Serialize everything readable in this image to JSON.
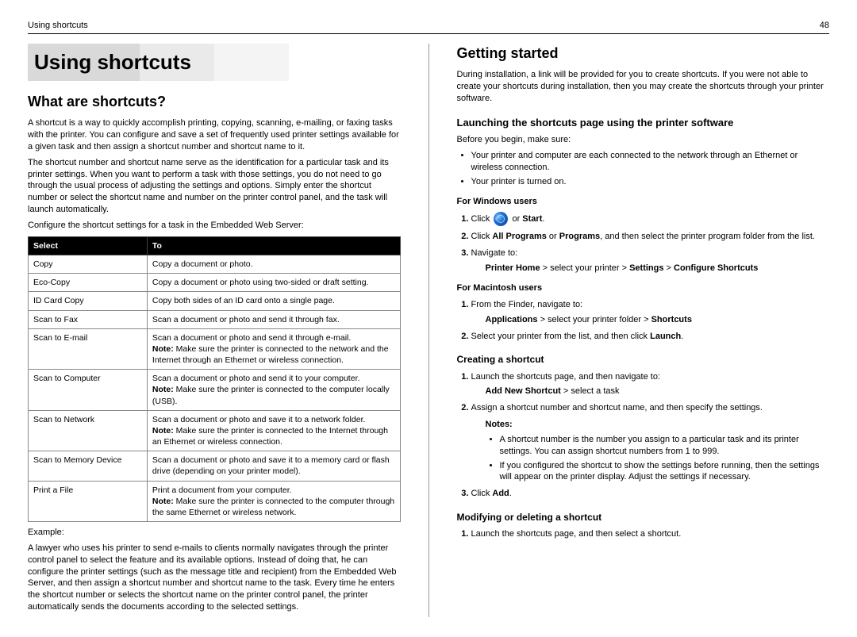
{
  "header": {
    "left": "Using shortcuts",
    "right": "48"
  },
  "left": {
    "banner": "Using shortcuts",
    "h2": "What are shortcuts?",
    "p1": "A shortcut is a way to quickly accomplish printing, copying, scanning, e-mailing, or faxing tasks with the printer. You can configure and save a set of frequently used printer settings available for a given task and then assign a shortcut number and shortcut name to it.",
    "p2": "The shortcut number and shortcut name serve as the identification for a particular task and its printer settings. When you want to perform a task with those settings, you do not need to go through the usual process of adjusting the settings and options. Simply enter the shortcut number or select the shortcut name and number on the printer control panel, and the task will launch automatically.",
    "p3": "Configure the shortcut settings for a task in the Embedded Web Server:",
    "table": {
      "head": [
        "Select",
        "To"
      ],
      "rows": [
        {
          "c1": "Copy",
          "c2": "Copy a document or photo."
        },
        {
          "c1": "Eco-Copy",
          "c2": "Copy a document or photo using two-sided or draft setting."
        },
        {
          "c1": "ID Card Copy",
          "c2": "Copy both sides of an ID card onto a single page."
        },
        {
          "c1": "Scan to Fax",
          "c2": "Scan a document or photo and send it through fax."
        },
        {
          "c1": "Scan to E-mail",
          "c2": "Scan a document or photo and send it through e-mail.",
          "note": "Make sure the printer is connected to the network and the Internet through an Ethernet or wireless connection."
        },
        {
          "c1": "Scan to Computer",
          "c2": "Scan a document or photo and send it to your computer.",
          "note": "Make sure the printer is connected to the computer locally (USB)."
        },
        {
          "c1": "Scan to Network",
          "c2": "Scan a document or photo and save it to a network folder.",
          "note": "Make sure the printer is connected to the Internet through an Ethernet or wireless connection."
        },
        {
          "c1": "Scan to Memory Device",
          "c2": "Scan a document or photo and save it to a memory card or flash drive (depending on your printer model)."
        },
        {
          "c1": "Print a File",
          "c2": "Print a document from your computer.",
          "note": "Make sure the printer is connected to the computer through the same Ethernet or wireless network."
        }
      ]
    },
    "example_label": "Example:",
    "example_body": "A lawyer who uses his printer to send e-mails to clients normally navigates through the printer control panel to select the feature and its available options. Instead of doing that, he can configure the printer settings (such as the message title and recipient) from the Embedded Web Server, and then assign a shortcut number and shortcut name to the task. Every time he enters the shortcut number or selects the shortcut name on the printer control panel, the printer automatically sends the documents according to the selected settings."
  },
  "right": {
    "h2": "Getting started",
    "intro": "During installation, a link will be provided for you to create shortcuts. If you were not able to create your shortcuts during installation, then you may create the shortcuts through your printer software.",
    "launch_h3": "Launching the shortcuts page using the printer software",
    "before": "Before you begin, make sure:",
    "before_list": [
      "Your printer and computer are each connected to the network through an Ethernet or wireless connection.",
      "Your printer is turned on."
    ],
    "win_h5": "For Windows users",
    "win_steps": {
      "s1a": "Click ",
      "s1b": " or ",
      "s1c": "Start",
      "s1d": ".",
      "s2a": "Click ",
      "s2b": "All Programs",
      "s2c": " or ",
      "s2d": "Programs",
      "s2e": ", and then select the printer program folder from the list.",
      "s3": "Navigate to:",
      "s3path_a": "Printer Home",
      "s3path_b": " > select your printer > ",
      "s3path_c": "Settings",
      "s3path_d": " > ",
      "s3path_e": "Configure Shortcuts"
    },
    "mac_h5": "For Macintosh users",
    "mac_steps": {
      "s1": "From the Finder, navigate to:",
      "s1path_a": "Applications",
      "s1path_b": " > select your printer folder > ",
      "s1path_c": "Shortcuts",
      "s2a": "Select your printer from the list, and then click ",
      "s2b": "Launch",
      "s2c": "."
    },
    "create_h4": "Creating a shortcut",
    "create_steps": {
      "s1": "Launch the shortcuts page, and then navigate to:",
      "s1path_a": "Add New Shortcut",
      "s1path_b": " > select a task",
      "s2": "Assign a shortcut number and shortcut name, and then specify the settings.",
      "notes_label": "Notes:",
      "notes": [
        "A shortcut number is the number you assign to a particular task and its printer settings. You can assign shortcut numbers from 1 to 999.",
        "If you configured the shortcut to show the settings before running, then the settings will appear on the printer display. Adjust the settings if necessary."
      ],
      "s3a": "Click ",
      "s3b": "Add",
      "s3c": "."
    },
    "modify_h4": "Modifying or deleting a shortcut",
    "modify_s1": "Launch the shortcuts page, and then select a shortcut."
  },
  "labels": {
    "note_prefix": "Note: "
  }
}
